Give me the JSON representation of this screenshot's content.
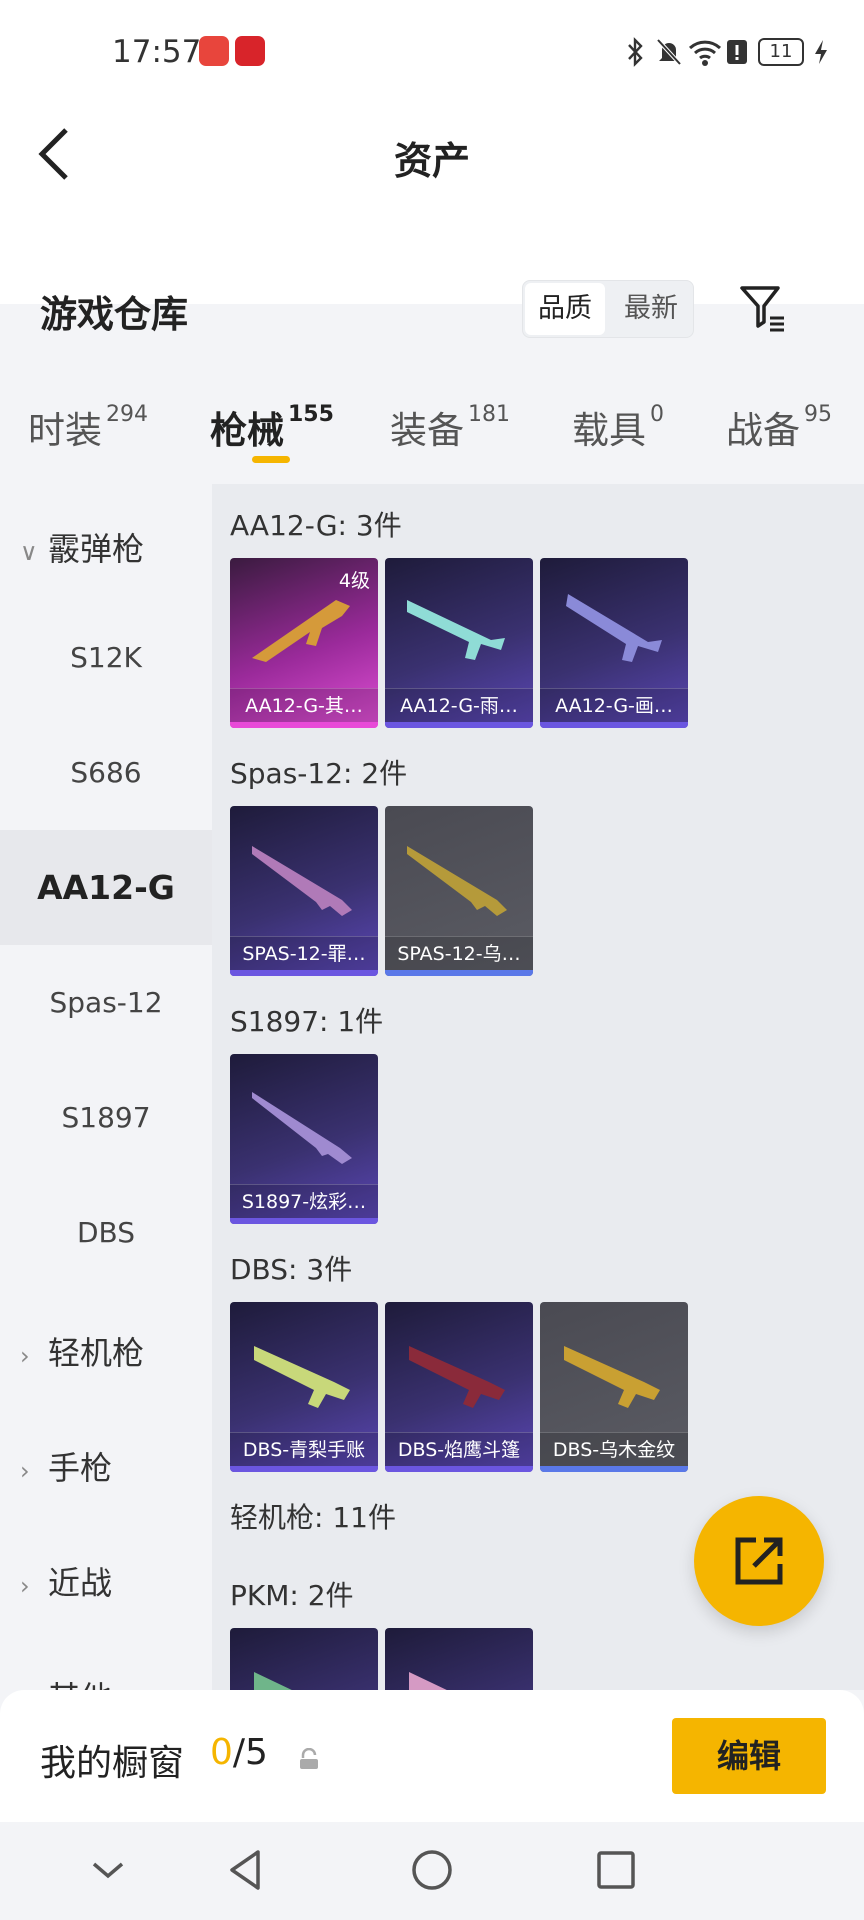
{
  "status": {
    "time": "17:57",
    "battery": "11"
  },
  "header": {
    "title": "资产",
    "section": "游戏仓库",
    "sort_quality": "品质",
    "sort_latest": "最新"
  },
  "tabs": [
    {
      "label": "时装",
      "count": "294"
    },
    {
      "label": "枪械",
      "count": "155"
    },
    {
      "label": "装备",
      "count": "181"
    },
    {
      "label": "载具",
      "count": "0"
    },
    {
      "label": "战备",
      "count": "95"
    }
  ],
  "sidebar": {
    "cat_shotgun": "霰弹枪",
    "items": [
      "S12K",
      "S686",
      "AA12-G",
      "Spas-12",
      "S1897",
      "DBS"
    ],
    "cat_lmg": "轻机枪",
    "cat_pistol": "手枪",
    "cat_melee": "近战",
    "cat_other": "其他"
  },
  "groups": {
    "aa12": {
      "label": "AA12-G: 3件",
      "cards": [
        "AA12-G-其…",
        "AA12-G-雨…",
        "AA12-G-画…"
      ],
      "level": "4级"
    },
    "spas": {
      "label": "Spas-12: 2件",
      "cards": [
        "SPAS-12-罪…",
        "SPAS-12-乌…"
      ]
    },
    "s1897": {
      "label": "S1897: 1件",
      "cards": [
        "S1897-炫彩…"
      ]
    },
    "dbs": {
      "label": "DBS: 3件",
      "cards": [
        "DBS-青梨手账",
        "DBS-焰鹰斗篷",
        "DBS-乌木金纹"
      ]
    },
    "lmg": {
      "label": "轻机枪: 11件"
    },
    "pkm": {
      "label": "PKM: 2件"
    }
  },
  "footer": {
    "title": "我的橱窗",
    "count_used": "0",
    "count_total": "/5",
    "edit": "编辑"
  }
}
